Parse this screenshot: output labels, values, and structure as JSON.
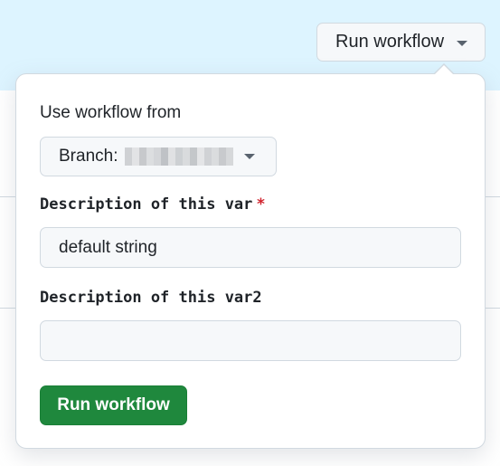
{
  "toolbar": {
    "run_workflow_label": "Run workflow"
  },
  "popover": {
    "heading": "Use workflow from",
    "branch": {
      "label": "Branch:",
      "value_state": "redacted"
    },
    "fields": [
      {
        "label": "Description of this var",
        "required_marker": "*",
        "value": "default string",
        "placeholder": ""
      },
      {
        "label": "Description of this var2",
        "value": "",
        "placeholder": ""
      }
    ],
    "submit_label": "Run workflow"
  },
  "colors": {
    "banner": "#ddf4ff",
    "primary_button": "#1f883d",
    "required": "#d1242f",
    "input_bg": "#f6f8fa",
    "border": "#d1d9e0"
  },
  "icons": {
    "toggle_caret": "triangle-down-icon",
    "branch_caret": "triangle-down-icon"
  }
}
